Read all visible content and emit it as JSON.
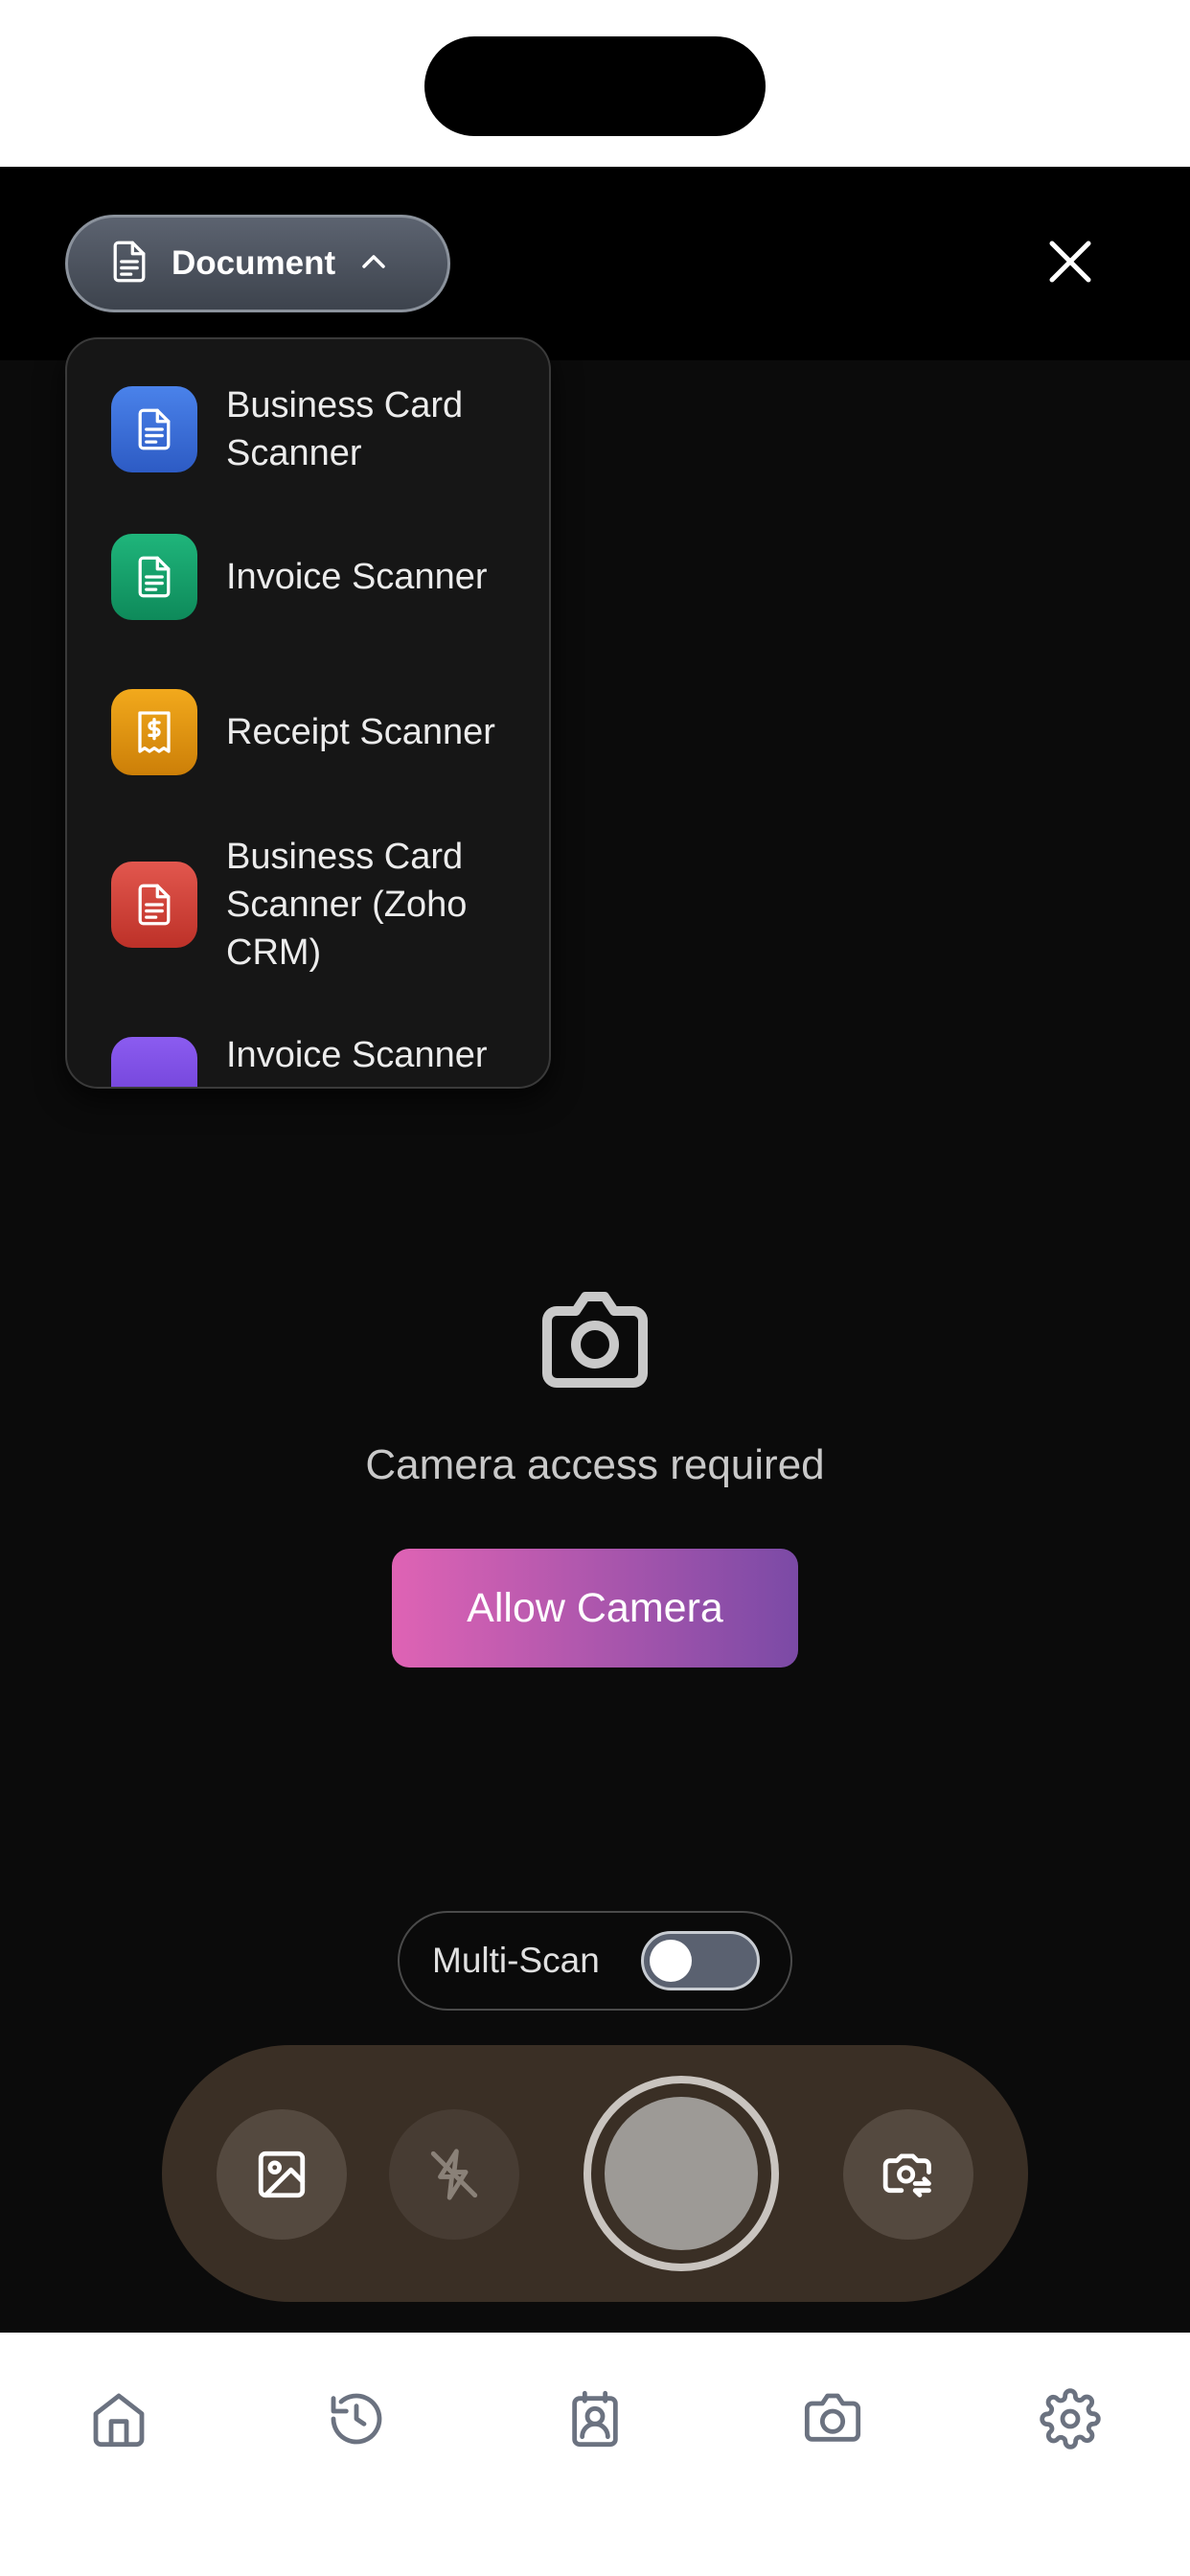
{
  "header": {
    "mode_label": "Document",
    "mode_icon": "document-icon",
    "close_icon": "close-icon"
  },
  "dropdown": {
    "items": [
      {
        "label": "Business Card Scanner",
        "icon": "document-icon",
        "color": "#3b6fd9"
      },
      {
        "label": "Invoice Scanner",
        "icon": "document-icon",
        "color": "#12a06a"
      },
      {
        "label": "Receipt Scanner",
        "icon": "receipt-icon",
        "color": "#e0940e"
      },
      {
        "label": "Business Card Scanner (Zoho CRM)",
        "icon": "document-icon",
        "color": "#d5453c"
      },
      {
        "label": "Invoice Scanner",
        "icon": "document-icon",
        "color": "#7b4ce0"
      }
    ]
  },
  "camera": {
    "message": "Camera access required",
    "allow_label": "Allow Camera",
    "allow_colors": [
      "#df63b4",
      "#7b4aa6"
    ]
  },
  "multiscan": {
    "label": "Multi-Scan",
    "enabled": false
  },
  "controls": {
    "gallery_icon": "image-icon",
    "flash_icon": "flash-off-icon",
    "shutter": "shutter-button",
    "flip_icon": "flip-camera-icon"
  },
  "tabbar": {
    "tabs": [
      {
        "icon": "home-icon"
      },
      {
        "icon": "history-icon"
      },
      {
        "icon": "contact-card-icon"
      },
      {
        "icon": "camera-icon"
      },
      {
        "icon": "settings-icon"
      }
    ]
  }
}
